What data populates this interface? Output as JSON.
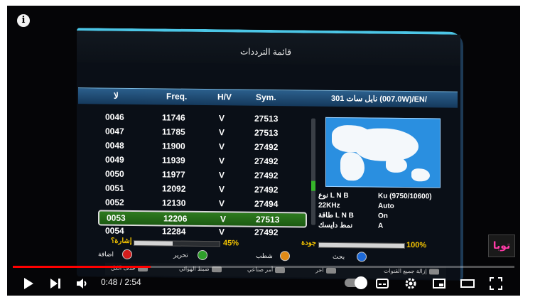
{
  "player": {
    "info_icon_text": "i",
    "time": "0:48 / 2:54",
    "progress_fraction": 0.275,
    "watermark": "توبا"
  },
  "tv": {
    "title": "قائمة الترددات",
    "headers": {
      "num": "لا",
      "freq": "Freq.",
      "hv": "H/V",
      "sym": "Sym."
    },
    "satellite": "نايل سات 301 (007.0W)/EN/",
    "rows": [
      {
        "num": "0046",
        "freq": "11746",
        "hv": "V",
        "sym": "27513"
      },
      {
        "num": "0047",
        "freq": "11785",
        "hv": "V",
        "sym": "27513"
      },
      {
        "num": "0048",
        "freq": "11900",
        "hv": "V",
        "sym": "27492"
      },
      {
        "num": "0049",
        "freq": "11939",
        "hv": "V",
        "sym": "27492"
      },
      {
        "num": "0050",
        "freq": "11977",
        "hv": "V",
        "sym": "27492"
      },
      {
        "num": "0051",
        "freq": "12092",
        "hv": "V",
        "sym": "27492"
      },
      {
        "num": "0052",
        "freq": "12130",
        "hv": "V",
        "sym": "27494"
      },
      {
        "num": "0053",
        "freq": "12206",
        "hv": "V",
        "sym": "27513"
      },
      {
        "num": "0054",
        "freq": "12284",
        "hv": "V",
        "sym": "27492"
      }
    ],
    "selected_index": 7,
    "info": [
      {
        "label": "نوع L N B",
        "value": "Ku (9750/10600)"
      },
      {
        "label": "22KHz",
        "value": "Auto"
      },
      {
        "label": "طاقة L N B",
        "value": "On"
      },
      {
        "label": "نمط دايسك",
        "value": "A"
      }
    ],
    "signal": {
      "label": "إشارة؟",
      "percent": "45%",
      "level": 0.45
    },
    "quality": {
      "label": "جودة",
      "percent": "100%",
      "level": 1.0
    },
    "keys": [
      {
        "label": "اضافة",
        "color": "#d21d1d"
      },
      {
        "label": "تحرير",
        "color": "#2fa02a"
      },
      {
        "label": "شطب",
        "color": "#e08a16"
      },
      {
        "label": "بحث",
        "color": "#1e6ad8"
      }
    ],
    "legend": [
      "حذف الكل",
      "ضبط الهوائي",
      "أمر صناعي",
      "اخر",
      "إزالة جميع القنوات"
    ]
  }
}
